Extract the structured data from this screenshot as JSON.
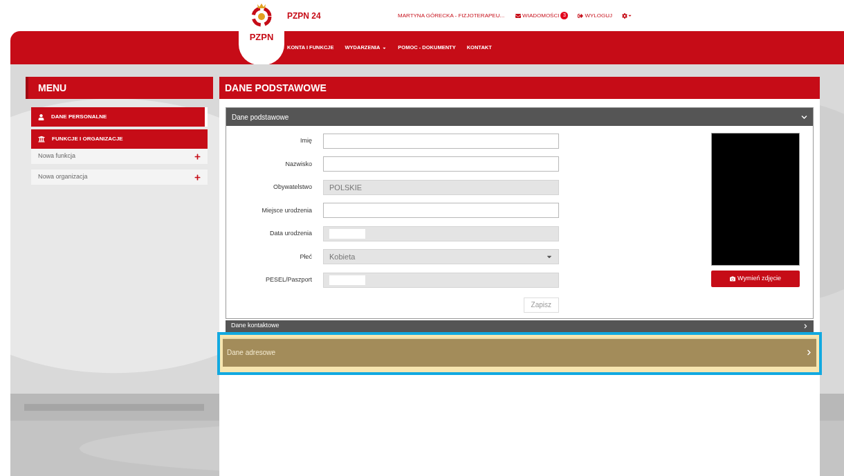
{
  "header": {
    "logo_text": "PZPN",
    "app_title": "PZPN 24",
    "user": "MARTYNA GÓRECKA - FIZJOTERAPEU...",
    "messages": {
      "label": "WIADOMOŚCI",
      "count": "3"
    },
    "logout": "WYLOGUJ"
  },
  "nav": [
    {
      "label": "KONTA I FUNKCJE",
      "dropdown": false
    },
    {
      "label": "WYDARZENIA",
      "dropdown": true
    },
    {
      "label": "POMOC - DOKUMENTY",
      "dropdown": false
    },
    {
      "label": "KONTAKT",
      "dropdown": false
    }
  ],
  "menu": {
    "title": "MENU",
    "sections": [
      {
        "kind": "person",
        "label": "DANE PERSONALNE",
        "selected": true
      },
      {
        "kind": "building",
        "label": "FUNKCJE I ORGANIZACJE",
        "selected": false,
        "children": [
          {
            "label": "Nowa funkcja"
          },
          {
            "label": "Nowa organizacja"
          }
        ]
      }
    ]
  },
  "page_title": "DANE PODSTAWOWE",
  "form_panel": {
    "title": "Dane podstawowe",
    "expanded": true,
    "fields": [
      {
        "kind": "text",
        "label": "Imię",
        "disabled": false
      },
      {
        "kind": "text",
        "label": "Nazwisko",
        "disabled": false
      },
      {
        "kind": "text",
        "label": "Obywatelstwo",
        "value": "POLSKIE",
        "disabled": true
      },
      {
        "kind": "text",
        "label": "Miejsce urodzenia",
        "disabled": false
      },
      {
        "kind": "redacted",
        "label": "Data urodzenia",
        "disabled": true
      },
      {
        "kind": "select",
        "label": "Płeć",
        "value": "Kobieta",
        "disabled": true
      },
      {
        "kind": "redacted",
        "label": "PESEL/Paszport",
        "disabled": true
      }
    ],
    "save_button": "Zapisz",
    "photo_button": "Wymień zdjęcie"
  },
  "collapsed_panels": [
    {
      "title": "Dane kontaktowe",
      "highlighted": false
    },
    {
      "title": "Dane adresowe",
      "highlighted": true
    }
  ]
}
